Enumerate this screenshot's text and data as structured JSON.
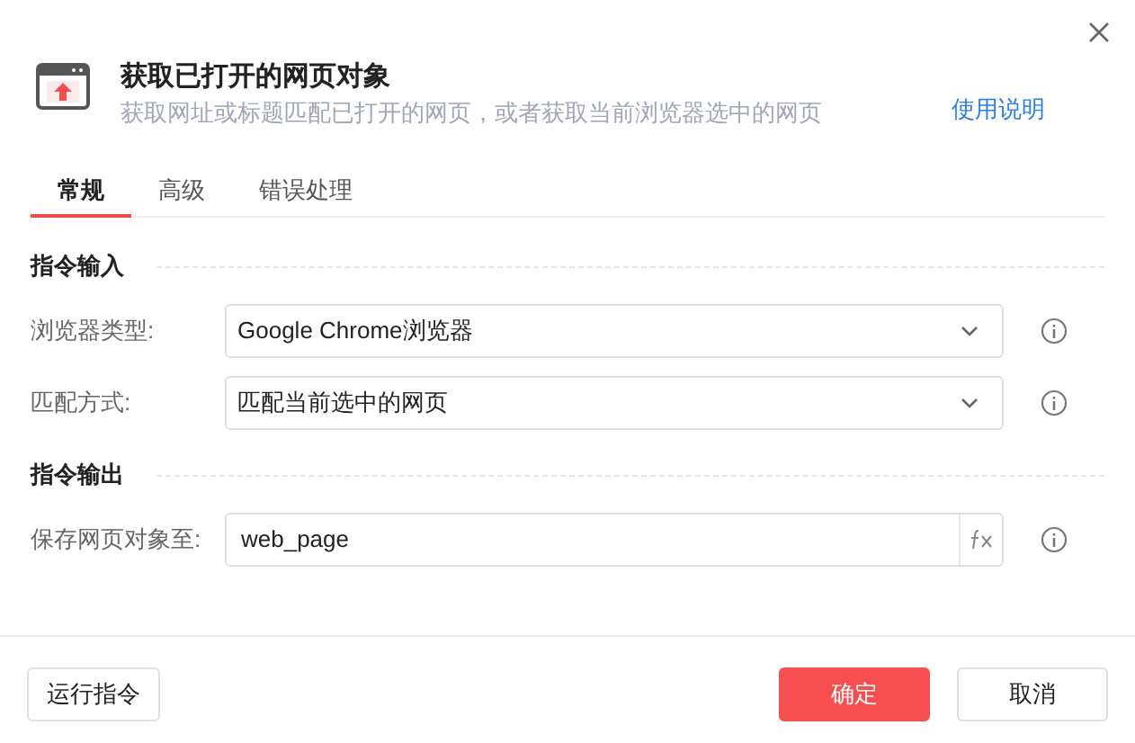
{
  "header": {
    "title": "获取已打开的网页对象",
    "subtitle": "获取网址或标题匹配已打开的网页，或者获取当前浏览器选中的网页",
    "help_link": "使用说明"
  },
  "tabs": [
    {
      "label": "常规",
      "selected": true
    },
    {
      "label": "高级",
      "selected": false
    },
    {
      "label": "错误处理",
      "selected": false
    }
  ],
  "sections": [
    {
      "title": "指令输入",
      "fields": [
        {
          "kind": "select",
          "label": "浏览器类型:",
          "value": "Google Chrome浏览器"
        },
        {
          "kind": "select",
          "label": "匹配方式:",
          "value": "匹配当前选中的网页"
        }
      ]
    },
    {
      "title": "指令输出",
      "fields": [
        {
          "kind": "expression",
          "label": "保存网页对象至:",
          "value": "web_page"
        }
      ]
    }
  ],
  "footer": {
    "run_button": "运行指令",
    "buttons": [
      {
        "label": "确定",
        "kind": "primary"
      },
      {
        "label": "取消",
        "kind": "default"
      }
    ]
  }
}
